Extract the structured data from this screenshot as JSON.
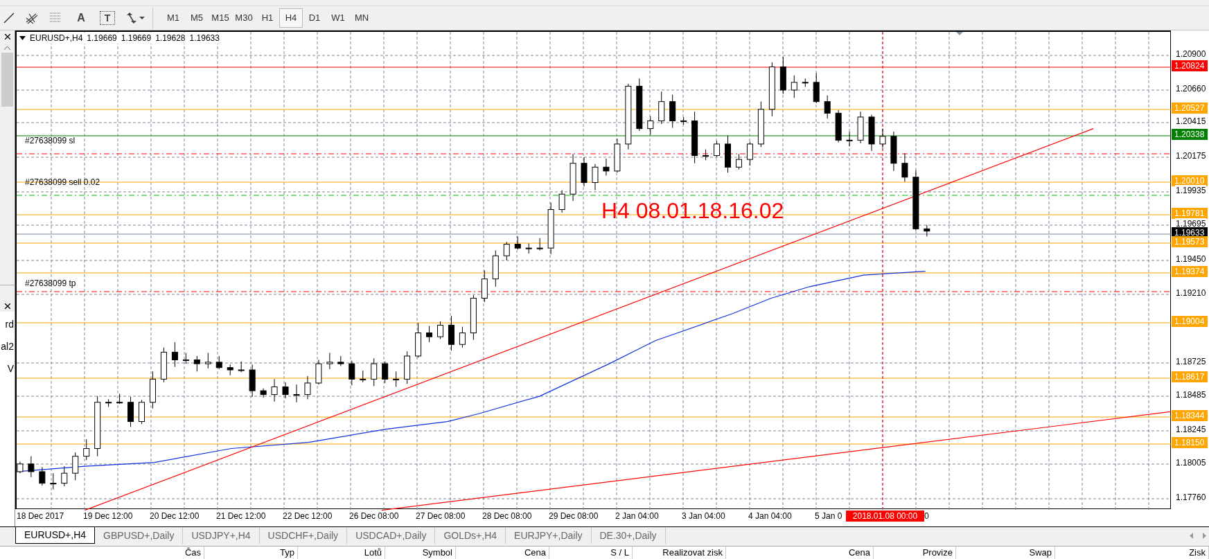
{
  "toolbar": {
    "tools": [
      {
        "kind": "line"
      },
      {
        "kind": "fibo"
      },
      {
        "kind": "grid"
      },
      {
        "kind": "text",
        "label": "A"
      },
      {
        "kind": "label",
        "label": "T"
      },
      {
        "kind": "arrows"
      }
    ],
    "timeframes": [
      {
        "label": "M1",
        "selected": false
      },
      {
        "label": "M5",
        "selected": false
      },
      {
        "label": "M15",
        "selected": false
      },
      {
        "label": "M30",
        "selected": false
      },
      {
        "label": "H1",
        "selected": false
      },
      {
        "label": "H4",
        "selected": true
      },
      {
        "label": "D1",
        "selected": false
      },
      {
        "label": "W1",
        "selected": false
      },
      {
        "label": "MN",
        "selected": false
      }
    ]
  },
  "navigator": {
    "texts": [
      "rd",
      "al2",
      "V"
    ]
  },
  "chart": {
    "header": {
      "symbol": "EURUSD+,H4",
      "values": [
        "1.19669",
        "1.19669",
        "1.19628",
        "1.19633"
      ]
    },
    "order_lines": [
      {
        "text": "#27638099 sl",
        "kind": "sl"
      },
      {
        "text": "#27638099 sell 0.02",
        "kind": "open"
      },
      {
        "text": "#27638099 tp",
        "kind": "tp"
      }
    ],
    "annotation": "H4 08.01.18.16.02",
    "price_axis": [
      {
        "text": "1.20900",
        "kind": "tick"
      },
      {
        "text": "1.20824",
        "kind": "marker",
        "color": "#ff0000"
      },
      {
        "text": "1.20660",
        "kind": "tick"
      },
      {
        "text": "1.20527",
        "kind": "marker",
        "color": "#ffa500"
      },
      {
        "text": "1.20415",
        "kind": "tick"
      },
      {
        "text": "1.20338",
        "kind": "marker",
        "color": "#008000"
      },
      {
        "text": "1.20175",
        "kind": "tick"
      },
      {
        "text": "1.20010",
        "kind": "marker",
        "color": "#ffa500"
      },
      {
        "text": "1.19935",
        "kind": "tick"
      },
      {
        "text": "1.19781",
        "kind": "marker",
        "color": "#ffa500"
      },
      {
        "text": "1.19695",
        "kind": "tick"
      },
      {
        "text": "1.19633",
        "kind": "bid"
      },
      {
        "text": "1.19573",
        "kind": "marker",
        "color": "#ffa500"
      },
      {
        "text": "1.19450",
        "kind": "tick"
      },
      {
        "text": "1.19374",
        "kind": "marker",
        "color": "#ffa500"
      },
      {
        "text": "1.19210",
        "kind": "tick"
      },
      {
        "text": "1.19004",
        "kind": "marker",
        "color": "#ffa500"
      },
      {
        "text": "1.18725",
        "kind": "tick"
      },
      {
        "text": "1.18617",
        "kind": "marker",
        "color": "#ffa500"
      },
      {
        "text": "1.18485",
        "kind": "tick"
      },
      {
        "text": "1.18344",
        "kind": "marker",
        "color": "#ffa500"
      },
      {
        "text": "1.18245",
        "kind": "tick"
      },
      {
        "text": "1.18150",
        "kind": "marker",
        "color": "#ffa500"
      },
      {
        "text": "1.18005",
        "kind": "tick"
      },
      {
        "text": "1.17760",
        "kind": "tick"
      }
    ],
    "time_axis": [
      "18 Dec 2017",
      "19 Dec 12:00",
      "20 Dec 12:00",
      "21 Dec 12:00",
      "22 Dec 12:00",
      "26 Dec 08:00",
      "27 Dec 08:00",
      "28 Dec 08:00",
      "29 Dec 08:00",
      "2 Jan 04:00",
      "3 Jan 04:00",
      "4 Jan 04:00",
      "5 Jan 0"
    ],
    "time_marker": "2018.01.08 00:00",
    "time_tail": "0"
  },
  "tabs": [
    {
      "label": "EURUSD+,H4",
      "selected": true
    },
    {
      "label": "GBPUSD+,Daily",
      "selected": false
    },
    {
      "label": "USDJPY+,H4",
      "selected": false
    },
    {
      "label": "USDCHF+,Daily",
      "selected": false
    },
    {
      "label": "USDCAD+,Daily",
      "selected": false
    },
    {
      "label": "GOLDs+,H4",
      "selected": false
    },
    {
      "label": "EURJPY+,Daily",
      "selected": false
    },
    {
      "label": "DE.30+,Daily",
      "selected": false
    }
  ],
  "table": {
    "columns": [
      "Čas",
      "Typ",
      "Lotů",
      "Symbol",
      "Cena",
      "S / L",
      "Realizovat zisk",
      "Cena",
      "Provize",
      "Swap",
      "Zisk"
    ]
  }
}
